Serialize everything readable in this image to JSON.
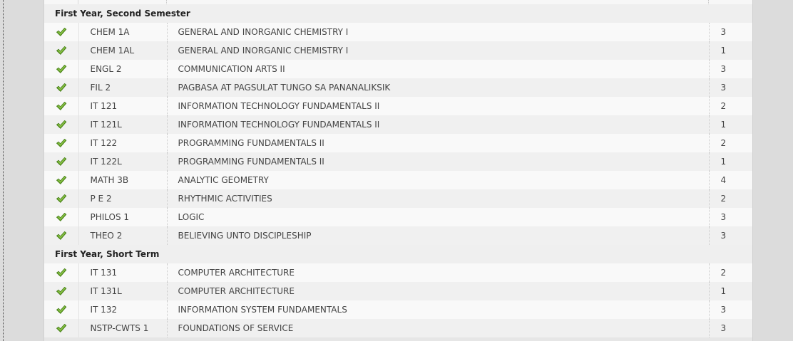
{
  "semesters": [
    {
      "heading": "First Year, Second Semester",
      "courses": [
        {
          "code": "CHEM 1A",
          "title": "GENERAL AND INORGANIC CHEMISTRY I",
          "units": "3",
          "icon": "check-icon"
        },
        {
          "code": "CHEM 1AL",
          "title": "GENERAL AND INORGANIC CHEMISTRY I",
          "units": "1",
          "icon": "check-icon"
        },
        {
          "code": "ENGL 2",
          "title": "COMMUNICATION ARTS II",
          "units": "3",
          "icon": "check-icon"
        },
        {
          "code": "FIL 2",
          "title": "PAGBASA AT PAGSULAT TUNGO SA PANANALIKSIK",
          "units": "3",
          "icon": "check-icon"
        },
        {
          "code": "IT 121",
          "title": "INFORMATION TECHNOLOGY FUNDAMENTALS II",
          "units": "2",
          "icon": "check-icon"
        },
        {
          "code": "IT 121L",
          "title": "INFORMATION TECHNOLOGY FUNDAMENTALS II",
          "units": "1",
          "icon": "check-icon"
        },
        {
          "code": "IT 122",
          "title": "PROGRAMMING FUNDAMENTALS II",
          "units": "2",
          "icon": "check-icon"
        },
        {
          "code": "IT 122L",
          "title": "PROGRAMMING FUNDAMENTALS II",
          "units": "1",
          "icon": "check-icon"
        },
        {
          "code": "MATH 3B",
          "title": "ANALYTIC GEOMETRY",
          "units": "4",
          "icon": "check-icon"
        },
        {
          "code": "P E 2",
          "title": "RHYTHMIC ACTIVITIES",
          "units": "2",
          "icon": "check-icon"
        },
        {
          "code": "PHILOS 1",
          "title": "LOGIC",
          "units": "3",
          "icon": "check-icon"
        },
        {
          "code": "THEO 2",
          "title": "BELIEVING UNTO DISCIPLESHIP",
          "units": "3",
          "icon": "check-icon"
        }
      ]
    },
    {
      "heading": "First Year, Short Term",
      "courses": [
        {
          "code": "IT 131",
          "title": "COMPUTER ARCHITECTURE",
          "units": "2",
          "icon": "check-icon"
        },
        {
          "code": "IT 131L",
          "title": "COMPUTER ARCHITECTURE",
          "units": "1",
          "icon": "check-icon"
        },
        {
          "code": "IT 132",
          "title": "INFORMATION SYSTEM FUNDAMENTALS",
          "units": "3",
          "icon": "check-icon"
        },
        {
          "code": "NSTP-CWTS 1",
          "title": "FOUNDATIONS OF SERVICE",
          "units": "3",
          "icon": "check-icon"
        }
      ]
    }
  ],
  "colors": {
    "check_green": "#6aa52a",
    "check_dark": "#3f7a12",
    "row_even": "#f0f0f0",
    "row_odd": "#f9f9f9",
    "heading_bg": "#efefef"
  }
}
